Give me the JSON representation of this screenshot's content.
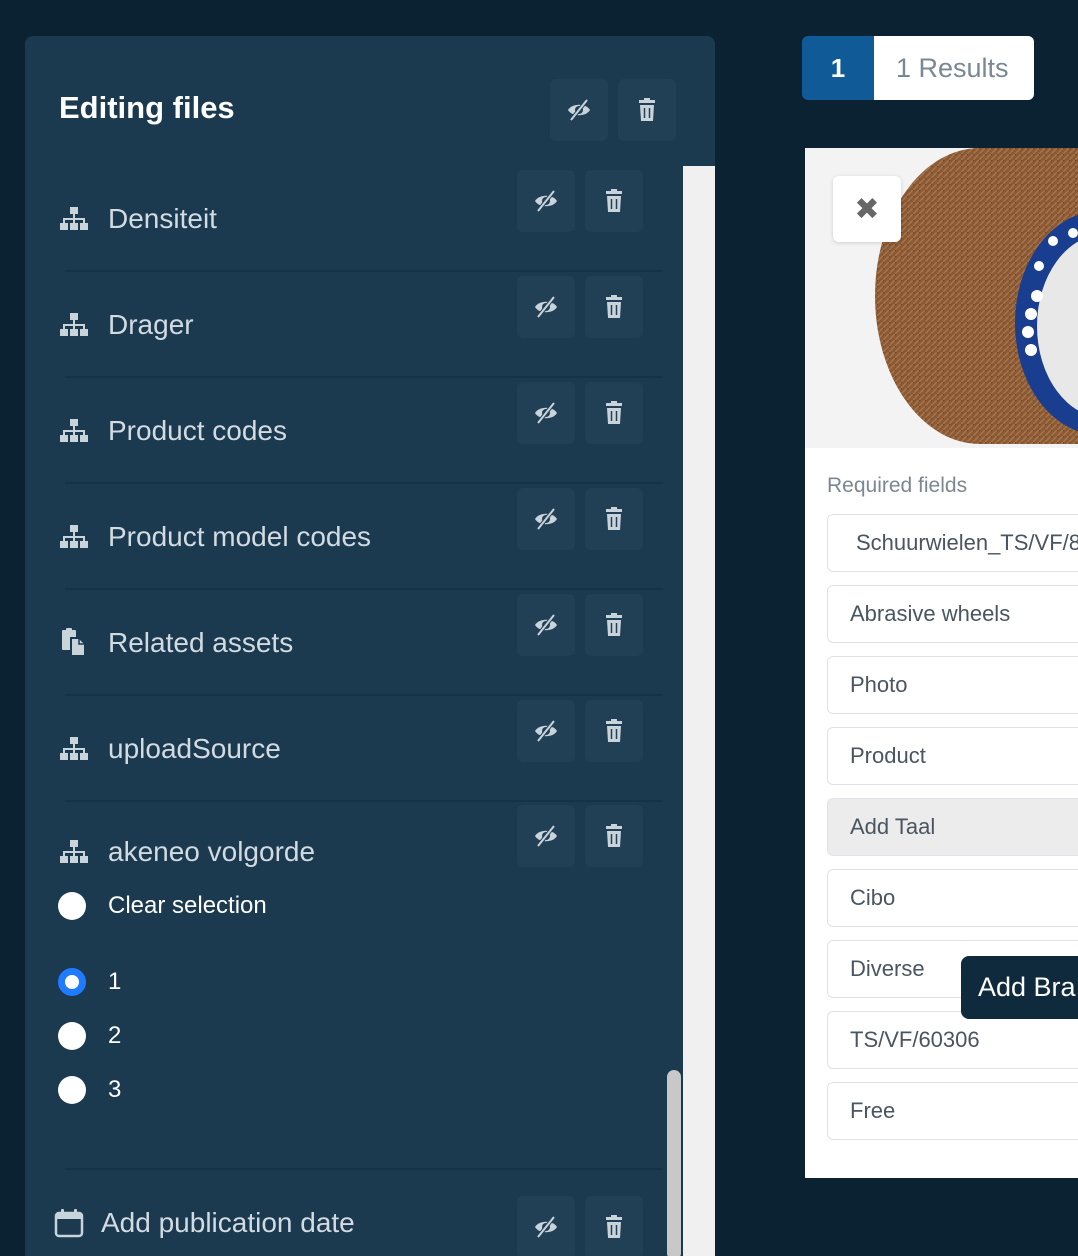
{
  "panel": {
    "title": "Editing files",
    "attributes": [
      {
        "label": "Densiteit",
        "icon": "sitemap-icon"
      },
      {
        "label": "Drager",
        "icon": "sitemap-icon"
      },
      {
        "label": "Product codes",
        "icon": "sitemap-icon"
      },
      {
        "label": "Product model codes",
        "icon": "sitemap-icon"
      },
      {
        "label": "Related assets",
        "icon": "copy-icon"
      },
      {
        "label": "uploadSource",
        "icon": "sitemap-icon"
      },
      {
        "label": "akeneo volgorde",
        "icon": "sitemap-icon"
      }
    ],
    "radio": {
      "clear_label": "Clear selection",
      "options": [
        "1",
        "2",
        "3"
      ],
      "selected": "1"
    },
    "publication_label": "Add publication date"
  },
  "pager": {
    "page": "1",
    "results": "1 Results"
  },
  "card": {
    "required_label": "Required fields",
    "fields": [
      "Schuurwielen_TS/VF/8",
      "Abrasive wheels",
      "Photo",
      "Product",
      "Add Taal",
      "Cibo",
      "Diverse",
      "TS/VF/60306",
      "Free"
    ],
    "tooltip": "Add Bra"
  },
  "colors": {
    "background": "#0b2233",
    "panel": "#1b3a4f",
    "accent": "#0f5a97",
    "radio_selected": "#1f7bff"
  }
}
